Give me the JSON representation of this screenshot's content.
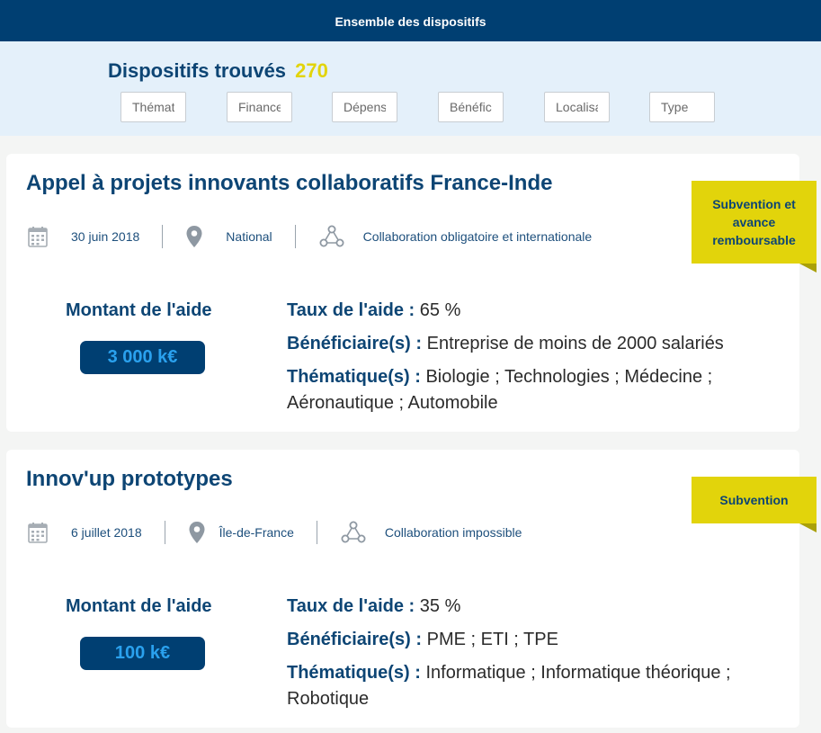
{
  "header": {
    "title": "Ensemble des dispositifs"
  },
  "search": {
    "title": "Dispositifs trouvés",
    "count": "270",
    "filters": [
      {
        "placeholder": "Thématique"
      },
      {
        "placeholder": "Financement"
      },
      {
        "placeholder": "Dépenses"
      },
      {
        "placeholder": "Bénéficiaires"
      },
      {
        "placeholder": "Localisation"
      },
      {
        "placeholder": "Type"
      }
    ]
  },
  "labels": {
    "amount": "Montant de l'aide",
    "rate": "Taux de l'aide :",
    "beneficiaries": "Bénéficiaire(s) :",
    "themes": "Thématique(s) :"
  },
  "cards": [
    {
      "title": "Appel à projets innovants collaboratifs France-Inde",
      "date": "30 juin 2018",
      "location": "National",
      "collaboration": "Collaboration obligatoire et internationale",
      "badge": "Subvention et avance remboursable",
      "amount": "3 000 k€",
      "rate": "65 %",
      "beneficiaries": "Entreprise de moins de 2000 salariés",
      "themes": "Biologie ; Technologies ; Médecine ; Aéronautique ; Automobile"
    },
    {
      "title": "Innov'up prototypes",
      "date": "6 juillet 2018",
      "location": "Île-de-France",
      "collaboration": "Collaboration impossible",
      "badge": "Subvention",
      "amount": "100 k€",
      "rate": "35 %",
      "beneficiaries": "PME ; ETI ; TPE",
      "themes": "Informatique ; Informatique théorique ; Robotique"
    }
  ],
  "icons": {
    "date": "calendar-icon",
    "location": "map-pin-icon",
    "collaboration": "network-icon"
  },
  "colors": {
    "header": "#003f72",
    "accent": "#e2d40b",
    "band": "#e4f0fa",
    "pill_text": "#2aa1ee"
  }
}
